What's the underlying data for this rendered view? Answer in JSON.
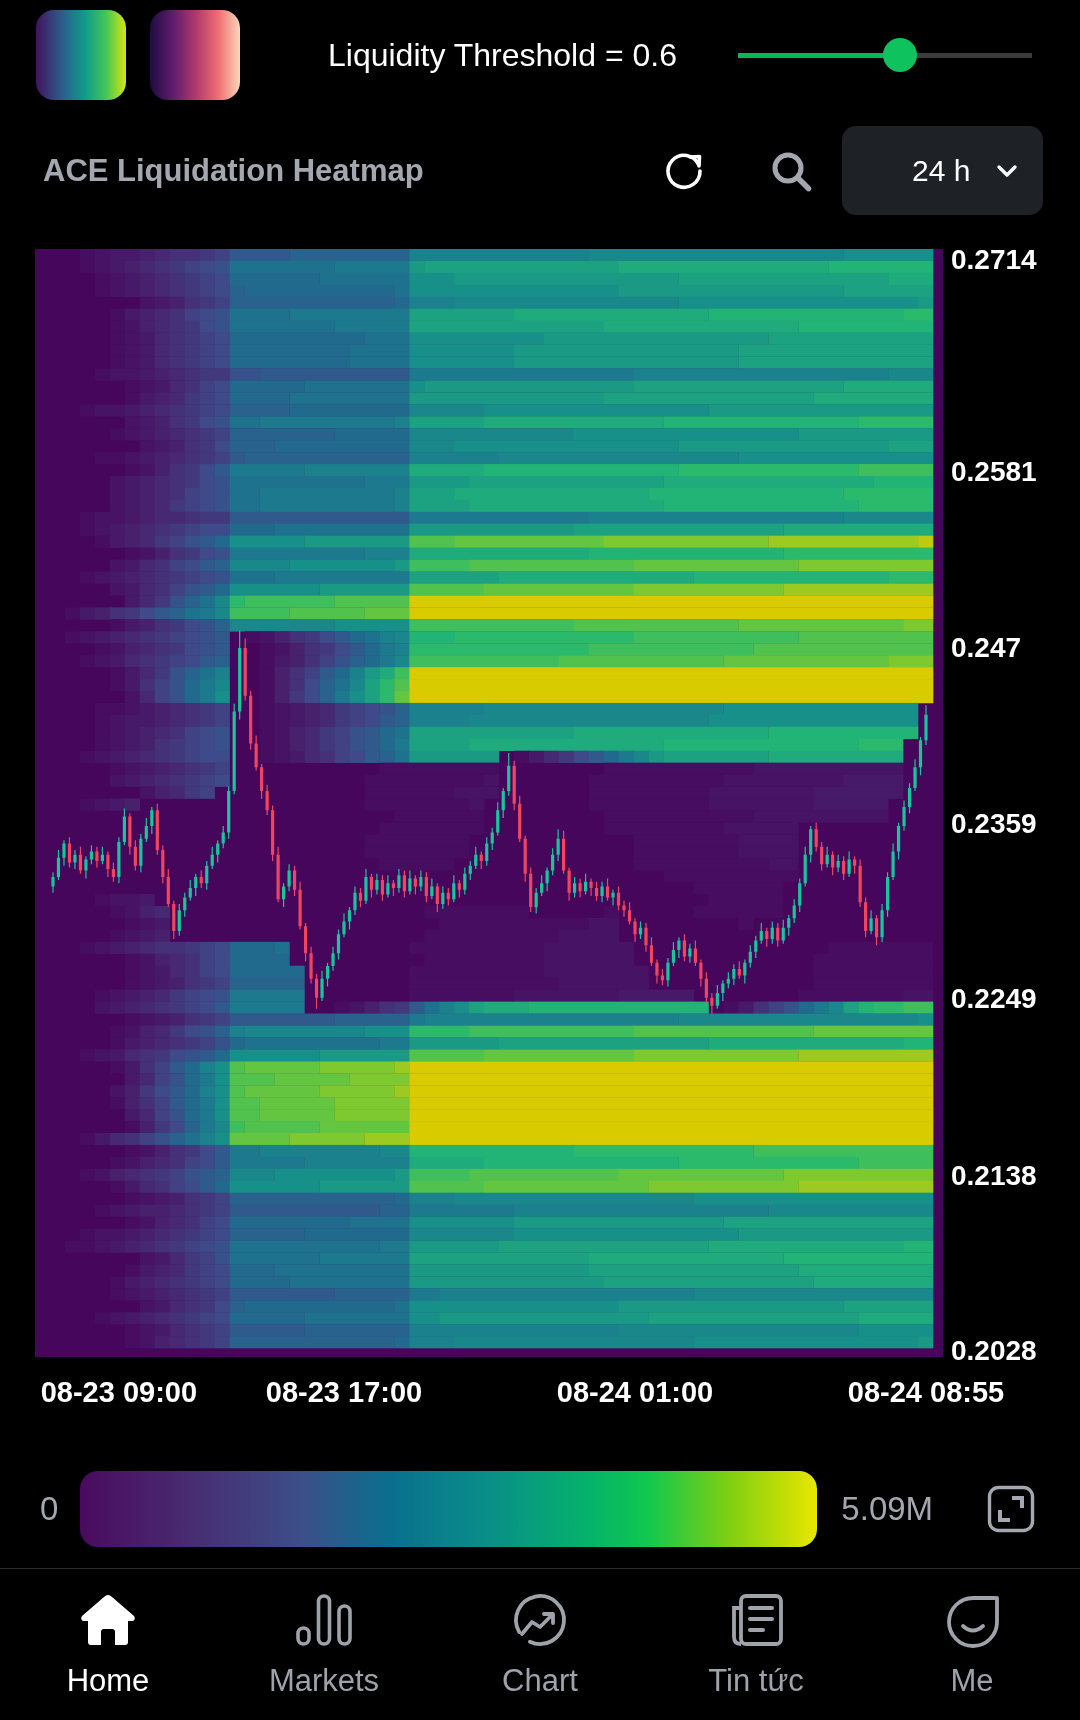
{
  "colormaps": [
    {
      "kind": "viridis"
    },
    {
      "kind": "magma"
    }
  ],
  "threshold": {
    "label": "Liquidity Threshold = 0.6",
    "level": 0.55
  },
  "header": {
    "title": "ACE Liquidation Heatmap",
    "range": "24 h"
  },
  "chart": {
    "chart_data": {
      "type": "candlestick",
      "ylim": [
        0.2024,
        0.2721
      ],
      "yticks": [
        {
          "value": 0.2714,
          "label": "0.2714"
        },
        {
          "value": 0.2581,
          "label": "0.2581"
        },
        {
          "value": 0.247,
          "label": "0.247"
        },
        {
          "value": 0.2359,
          "label": "0.2359"
        },
        {
          "value": 0.2249,
          "label": "0.2249"
        },
        {
          "value": 0.2138,
          "label": "0.2138"
        },
        {
          "value": 0.2028,
          "label": "0.2028"
        }
      ],
      "categories": [
        null,
        null,
        null,
        null,
        null,
        null,
        null,
        null,
        null,
        null,
        null,
        null,
        "08-23 09:00",
        null,
        null,
        null,
        null,
        null,
        null,
        null,
        null,
        null,
        null,
        null,
        null,
        null,
        null,
        null,
        null,
        null,
        null,
        null,
        null,
        null,
        null,
        null,
        null,
        null,
        null,
        null,
        null,
        null,
        null,
        null,
        null,
        null,
        null,
        null,
        null,
        null,
        null,
        null,
        null,
        "08-23 17:00",
        null,
        null,
        null,
        null,
        null,
        null,
        null,
        null,
        null,
        null,
        null,
        null,
        null,
        null,
        null,
        null,
        null,
        null,
        null,
        null,
        null,
        null,
        null,
        null,
        null,
        null,
        null,
        null,
        null,
        null,
        null,
        null,
        null,
        null,
        null,
        null,
        null,
        null,
        null,
        null,
        null,
        null,
        null,
        null,
        null,
        null,
        null,
        null,
        null,
        null,
        null,
        null,
        "08-24 01:00",
        null,
        null,
        null,
        null,
        null,
        null,
        null,
        null,
        null,
        null,
        null,
        null,
        null,
        null,
        null,
        null,
        null,
        null,
        null,
        null,
        null,
        null,
        null,
        null,
        null,
        null,
        null,
        null,
        null,
        null,
        null,
        null,
        null,
        null,
        null,
        null,
        null,
        null,
        null,
        null,
        null,
        null,
        null,
        null,
        null,
        null,
        null,
        null,
        null,
        null,
        null,
        null,
        "08-24 08:55"
      ],
      "ohlc": [
        [
          0.232,
          0.2329,
          0.2316,
          0.2326
        ],
        [
          0.2326,
          0.2343,
          0.2324,
          0.2338
        ],
        [
          0.2338,
          0.2349,
          0.2333,
          0.2347
        ],
        [
          0.2347,
          0.2351,
          0.2332,
          0.2335
        ],
        [
          0.2335,
          0.2343,
          0.2331,
          0.234
        ],
        [
          0.234,
          0.2345,
          0.2328,
          0.233
        ],
        [
          0.233,
          0.2339,
          0.2325,
          0.2337
        ],
        [
          0.2337,
          0.2346,
          0.2334,
          0.2342
        ],
        [
          0.2342,
          0.2345,
          0.2332,
          0.2336
        ],
        [
          0.2336,
          0.2345,
          0.2334,
          0.234
        ],
        [
          0.234,
          0.2342,
          0.2326,
          0.2331
        ],
        [
          0.2331,
          0.2335,
          0.2323,
          0.2326
        ],
        [
          0.2326,
          0.2351,
          0.2322,
          0.2348
        ],
        [
          0.2348,
          0.2369,
          0.2346,
          0.2364
        ],
        [
          0.2364,
          0.2366,
          0.234,
          0.2345
        ],
        [
          0.2345,
          0.2349,
          0.233,
          0.2333
        ],
        [
          0.2333,
          0.2353,
          0.2329,
          0.235
        ],
        [
          0.235,
          0.2363,
          0.2348,
          0.2358
        ],
        [
          0.2358,
          0.237,
          0.2353,
          0.2368
        ],
        [
          0.2368,
          0.2372,
          0.234,
          0.2343
        ],
        [
          0.2343,
          0.2346,
          0.2322,
          0.2326
        ],
        [
          0.2326,
          0.2331,
          0.2307,
          0.2309
        ],
        [
          0.2309,
          0.2311,
          0.2287,
          0.2292
        ],
        [
          0.2292,
          0.2309,
          0.2289,
          0.2305
        ],
        [
          0.2305,
          0.2316,
          0.2301,
          0.2313
        ],
        [
          0.2313,
          0.2324,
          0.2311,
          0.2319
        ],
        [
          0.2319,
          0.2328,
          0.2314,
          0.2326
        ],
        [
          0.2326,
          0.233,
          0.2319,
          0.2322
        ],
        [
          0.2322,
          0.2336,
          0.2318,
          0.2333
        ],
        [
          0.2333,
          0.2345,
          0.2331,
          0.234
        ],
        [
          0.234,
          0.2349,
          0.2335,
          0.2347
        ],
        [
          0.2347,
          0.2358,
          0.2344,
          0.2354
        ],
        [
          0.2354,
          0.2383,
          0.235,
          0.238
        ],
        [
          0.238,
          0.2435,
          0.2378,
          0.243
        ],
        [
          0.243,
          0.2481,
          0.2425,
          0.247
        ],
        [
          0.247,
          0.2476,
          0.2437,
          0.244
        ],
        [
          0.244,
          0.2443,
          0.2406,
          0.241
        ],
        [
          0.241,
          0.2415,
          0.2393,
          0.2395
        ],
        [
          0.2395,
          0.2397,
          0.2375,
          0.238
        ],
        [
          0.238,
          0.2384,
          0.2365,
          0.2368
        ],
        [
          0.2368,
          0.2371,
          0.2336,
          0.234
        ],
        [
          0.234,
          0.2345,
          0.231,
          0.2312
        ],
        [
          0.2312,
          0.2322,
          0.2307,
          0.232
        ],
        [
          0.232,
          0.2334,
          0.2317,
          0.233
        ],
        [
          0.233,
          0.2333,
          0.2314,
          0.2318
        ],
        [
          0.2318,
          0.2323,
          0.2293,
          0.2295
        ],
        [
          0.2295,
          0.2297,
          0.2273,
          0.2278
        ],
        [
          0.2278,
          0.2282,
          0.2259,
          0.2262
        ],
        [
          0.2262,
          0.2265,
          0.2243,
          0.225
        ],
        [
          0.225,
          0.2267,
          0.2248,
          0.2262
        ],
        [
          0.2262,
          0.2272,
          0.2257,
          0.227
        ],
        [
          0.227,
          0.2282,
          0.2267,
          0.2278
        ],
        [
          0.2278,
          0.2293,
          0.2274,
          0.229
        ],
        [
          0.229,
          0.2303,
          0.2288,
          0.2298
        ],
        [
          0.2298,
          0.2307,
          0.2293,
          0.2305
        ],
        [
          0.2305,
          0.232,
          0.2302,
          0.2316
        ],
        [
          0.2316,
          0.2319,
          0.2307,
          0.2311
        ],
        [
          0.2311,
          0.2331,
          0.2309,
          0.2326
        ],
        [
          0.2326,
          0.2328,
          0.2313,
          0.2318
        ],
        [
          0.2318,
          0.2328,
          0.2315,
          0.2324
        ],
        [
          0.2324,
          0.2327,
          0.2311,
          0.2315
        ],
        [
          0.2315,
          0.2327,
          0.2313,
          0.2322
        ],
        [
          0.2322,
          0.2324,
          0.2314,
          0.2319
        ],
        [
          0.2319,
          0.2331,
          0.2316,
          0.2327
        ],
        [
          0.2327,
          0.233,
          0.2313,
          0.2317
        ],
        [
          0.2317,
          0.233,
          0.2315,
          0.2325
        ],
        [
          0.2325,
          0.2327,
          0.2315,
          0.232
        ],
        [
          0.232,
          0.233,
          0.2317,
          0.2326
        ],
        [
          0.2326,
          0.2329,
          0.231,
          0.2314
        ],
        [
          0.2314,
          0.2325,
          0.2312,
          0.232
        ],
        [
          0.232,
          0.2322,
          0.2304,
          0.2309
        ],
        [
          0.2309,
          0.232,
          0.2306,
          0.2316
        ],
        [
          0.2316,
          0.2319,
          0.2308,
          0.2312
        ],
        [
          0.2312,
          0.2327,
          0.231,
          0.2322
        ],
        [
          0.2322,
          0.2324,
          0.2313,
          0.2318
        ],
        [
          0.2318,
          0.2332,
          0.2315,
          0.2328
        ],
        [
          0.2328,
          0.2336,
          0.2324,
          0.2333
        ],
        [
          0.2333,
          0.2345,
          0.2331,
          0.234
        ],
        [
          0.234,
          0.2342,
          0.2331,
          0.2336
        ],
        [
          0.2336,
          0.2351,
          0.2333,
          0.2347
        ],
        [
          0.2347,
          0.2357,
          0.2343,
          0.2354
        ],
        [
          0.2354,
          0.2373,
          0.2352,
          0.2368
        ],
        [
          0.2368,
          0.2382,
          0.2363,
          0.238
        ],
        [
          0.238,
          0.2404,
          0.2377,
          0.2396
        ],
        [
          0.2396,
          0.2399,
          0.2368,
          0.2372
        ],
        [
          0.2372,
          0.2377,
          0.2348,
          0.235
        ],
        [
          0.235,
          0.2352,
          0.2323,
          0.2328
        ],
        [
          0.2328,
          0.2332,
          0.2304,
          0.2307
        ],
        [
          0.2307,
          0.2319,
          0.2303,
          0.2316
        ],
        [
          0.2316,
          0.2327,
          0.2314,
          0.2322
        ],
        [
          0.2322,
          0.2332,
          0.2317,
          0.233
        ],
        [
          0.233,
          0.2344,
          0.2327,
          0.234
        ],
        [
          0.234,
          0.2356,
          0.2336,
          0.235
        ],
        [
          0.235,
          0.2355,
          0.2328,
          0.233
        ],
        [
          0.233,
          0.2332,
          0.2311,
          0.2316
        ],
        [
          0.2316,
          0.2326,
          0.2313,
          0.2322
        ],
        [
          0.2322,
          0.2325,
          0.2313,
          0.2317
        ],
        [
          0.2317,
          0.2328,
          0.2315,
          0.2323
        ],
        [
          0.2323,
          0.2325,
          0.2314,
          0.2319
        ],
        [
          0.2319,
          0.2323,
          0.2311,
          0.2314
        ],
        [
          0.2314,
          0.2323,
          0.231,
          0.232
        ],
        [
          0.232,
          0.2325,
          0.2311,
          0.2313
        ],
        [
          0.2313,
          0.2318,
          0.2308,
          0.2316
        ],
        [
          0.2316,
          0.232,
          0.2305,
          0.2308
        ],
        [
          0.2308,
          0.2311,
          0.2301,
          0.2305
        ],
        [
          0.2305,
          0.231,
          0.2296,
          0.2298
        ],
        [
          0.2298,
          0.23,
          0.2285,
          0.229
        ],
        [
          0.229,
          0.2298,
          0.2287,
          0.2294
        ],
        [
          0.2294,
          0.2297,
          0.2279,
          0.2283
        ],
        [
          0.2283,
          0.2288,
          0.227,
          0.2272
        ],
        [
          0.2272,
          0.2274,
          0.2259,
          0.2264
        ],
        [
          0.2264,
          0.2268,
          0.2258,
          0.2261
        ],
        [
          0.2261,
          0.2275,
          0.2257,
          0.2272
        ],
        [
          0.2272,
          0.2285,
          0.227,
          0.228
        ],
        [
          0.228,
          0.2288,
          0.2275,
          0.2286
        ],
        [
          0.2286,
          0.229,
          0.2273,
          0.2276
        ],
        [
          0.2276,
          0.2284,
          0.2272,
          0.2281
        ],
        [
          0.2281,
          0.2286,
          0.227,
          0.2272
        ],
        [
          0.2272,
          0.2274,
          0.2257,
          0.2262
        ],
        [
          0.2262,
          0.2266,
          0.2247,
          0.225
        ],
        [
          0.225,
          0.2253,
          0.224,
          0.2245
        ],
        [
          0.2245,
          0.2258,
          0.2243,
          0.2253
        ],
        [
          0.2253,
          0.2261,
          0.2248,
          0.2259
        ],
        [
          0.2259,
          0.2266,
          0.2256,
          0.2262
        ],
        [
          0.2262,
          0.2271,
          0.2258,
          0.2268
        ],
        [
          0.2268,
          0.2273,
          0.2262,
          0.2264
        ],
        [
          0.2264,
          0.2274,
          0.2259,
          0.2272
        ],
        [
          0.2272,
          0.2283,
          0.2269,
          0.2279
        ],
        [
          0.2279,
          0.2289,
          0.2275,
          0.2286
        ],
        [
          0.2286,
          0.2297,
          0.2284,
          0.2292
        ],
        [
          0.2292,
          0.2294,
          0.2282,
          0.2287
        ],
        [
          0.2287,
          0.2298,
          0.2284,
          0.2294
        ],
        [
          0.2294,
          0.2297,
          0.2282,
          0.2286
        ],
        [
          0.2286,
          0.2299,
          0.2284,
          0.2294
        ],
        [
          0.2294,
          0.2302,
          0.2289,
          0.23
        ],
        [
          0.23,
          0.2312,
          0.2297,
          0.2308
        ],
        [
          0.2308,
          0.2325,
          0.2304,
          0.2322
        ],
        [
          0.2322,
          0.2345,
          0.232,
          0.234
        ],
        [
          0.234,
          0.2358,
          0.2335,
          0.2356
        ],
        [
          0.2356,
          0.236,
          0.2342,
          0.2345
        ],
        [
          0.2345,
          0.2348,
          0.233,
          0.2334
        ],
        [
          0.2334,
          0.2345,
          0.2332,
          0.234
        ],
        [
          0.234,
          0.2342,
          0.2327,
          0.2332
        ],
        [
          0.2332,
          0.234,
          0.2329,
          0.2336
        ],
        [
          0.2336,
          0.2339,
          0.2324,
          0.2328
        ],
        [
          0.2328,
          0.2342,
          0.2326,
          0.2337
        ],
        [
          0.2337,
          0.2339,
          0.2328,
          0.2333
        ],
        [
          0.2333,
          0.2337,
          0.2307,
          0.231
        ],
        [
          0.231,
          0.2313,
          0.2288,
          0.2292
        ],
        [
          0.2292,
          0.2305,
          0.229,
          0.23
        ],
        [
          0.23,
          0.2302,
          0.2283,
          0.2288
        ],
        [
          0.2288,
          0.2309,
          0.2285,
          0.2305
        ],
        [
          0.2305,
          0.2329,
          0.2301,
          0.2326
        ],
        [
          0.2326,
          0.2347,
          0.2324,
          0.2342
        ],
        [
          0.2342,
          0.236,
          0.2337,
          0.2358
        ],
        [
          0.2358,
          0.2374,
          0.2355,
          0.237
        ],
        [
          0.237,
          0.2385,
          0.2366,
          0.2382
        ],
        [
          0.2382,
          0.24,
          0.238,
          0.2395
        ],
        [
          0.2395,
          0.2414,
          0.239,
          0.2412
        ],
        [
          0.2412,
          0.2434,
          0.2409,
          0.2428
        ]
      ]
    }
  },
  "legend": {
    "min": "0",
    "max": "5.09M"
  },
  "nav": [
    {
      "kind": "home",
      "label": "Home",
      "selected": true
    },
    {
      "kind": "markets",
      "label": "Markets",
      "selected": false
    },
    {
      "kind": "chart",
      "label": "Chart",
      "selected": false
    },
    {
      "kind": "news",
      "label": "Tin tức",
      "selected": false
    },
    {
      "kind": "me",
      "label": "Me",
      "selected": false
    }
  ]
}
